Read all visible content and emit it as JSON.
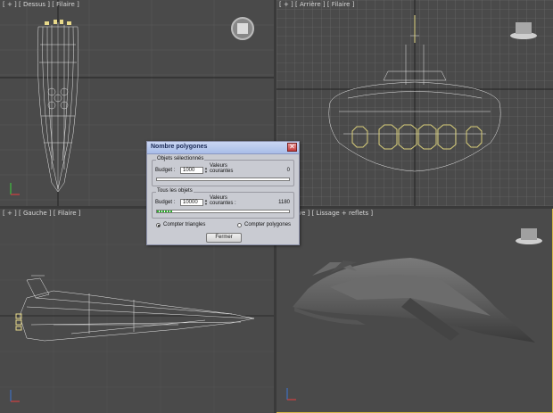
{
  "viewports": {
    "top_left_label": "[ + ] [ Dessus ] [ Filaire ]",
    "top_right_label": "[ + ] [ Arrière ] [ Filaire ]",
    "bottom_left_label": "[ + ] [ Gauche ] [ Filaire ]",
    "bottom_right_label": "spective ] [ Lissage + reflets ]"
  },
  "dialog": {
    "title": "Nombre polygones",
    "close_glyph": "✕",
    "selected_group": {
      "title": "Objets sélectionnés",
      "budget_label": "Budget :",
      "budget_value": "1000",
      "current_label_1": "Valeurs",
      "current_label_2": "courantes",
      "current_value": "0",
      "progress": 0.0
    },
    "all_group": {
      "title": "Tous les objets",
      "budget_label": "Budget :",
      "budget_value": "10000",
      "current_label_1": "Valeurs",
      "current_label_2": "courantes :",
      "current_value": "1180",
      "progress": 0.118
    },
    "radio_triangles": "Compter triangles",
    "radio_polygons": "Compter polygones",
    "selected_mode": "triangles",
    "close_button": "Fermer"
  },
  "colors": {
    "viewport_bg": "#4a4a4a",
    "wire": "#d8d8d8",
    "active_border": "#d7b84a",
    "progress_fill": "#2bb02b"
  }
}
